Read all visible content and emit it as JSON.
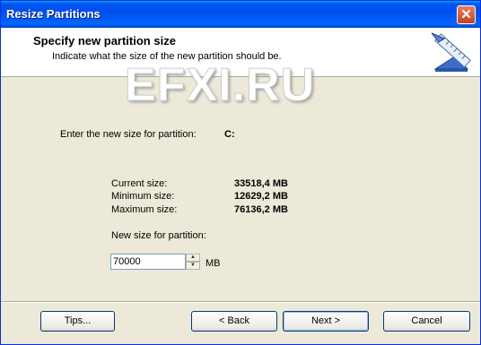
{
  "window": {
    "title": "Resize Partitions",
    "close_glyph": "✕"
  },
  "header": {
    "title": "Specify new partition size",
    "subtitle": "Indicate what the size of the new partition should be.",
    "icon": "ruler-icon"
  },
  "watermark": "EFXI.RU",
  "partition": {
    "prompt": "Enter the new size for partition:",
    "letter": "C:"
  },
  "sizes": {
    "current_label": "Current size:",
    "current_value": "33518,4 MB",
    "min_label": "Minimum size:",
    "min_value": "12629,2 MB",
    "max_label": "Maximum size:",
    "max_value": "76136,2 MB"
  },
  "new_size": {
    "label": "New size for partition:",
    "value": "70000",
    "unit": "MB"
  },
  "buttons": {
    "tips": "Tips...",
    "back": "< Back",
    "next": "Next >",
    "cancel": "Cancel"
  }
}
